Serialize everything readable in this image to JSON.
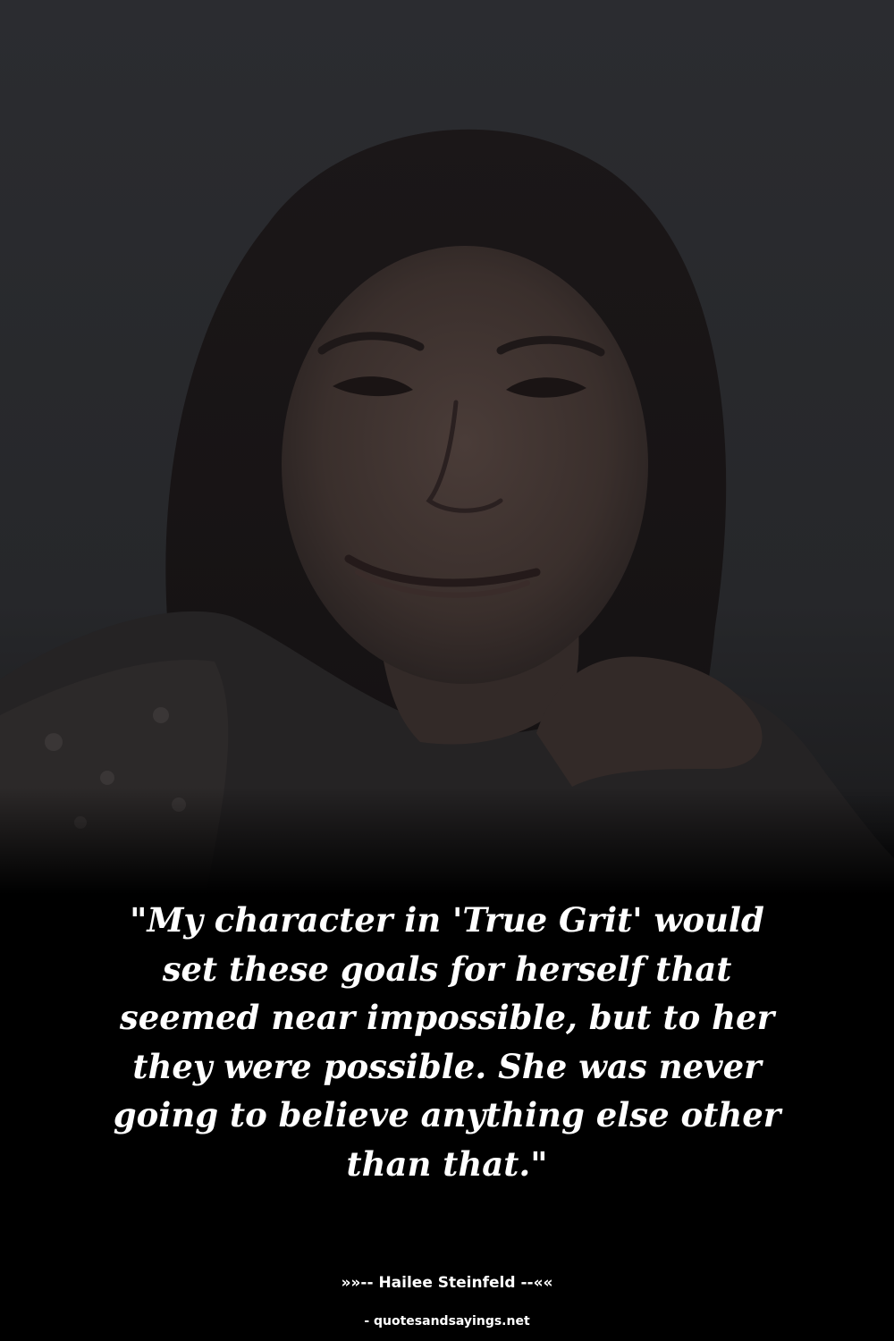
{
  "quote": {
    "text": "\"My character in 'True Grit' would set these goals for herself that seemed near impossible, but to her they were possible. She was never going to believe anything else other than that.\""
  },
  "attribution": {
    "prefix": "»»-- ",
    "author": "Hailee Steinfeld",
    "suffix": " --««"
  },
  "source": {
    "text": "- quotesandsayings.net"
  },
  "colors": {
    "background": "#000000",
    "photo_tint": "#2b2b2d",
    "text": "#ffffff"
  }
}
